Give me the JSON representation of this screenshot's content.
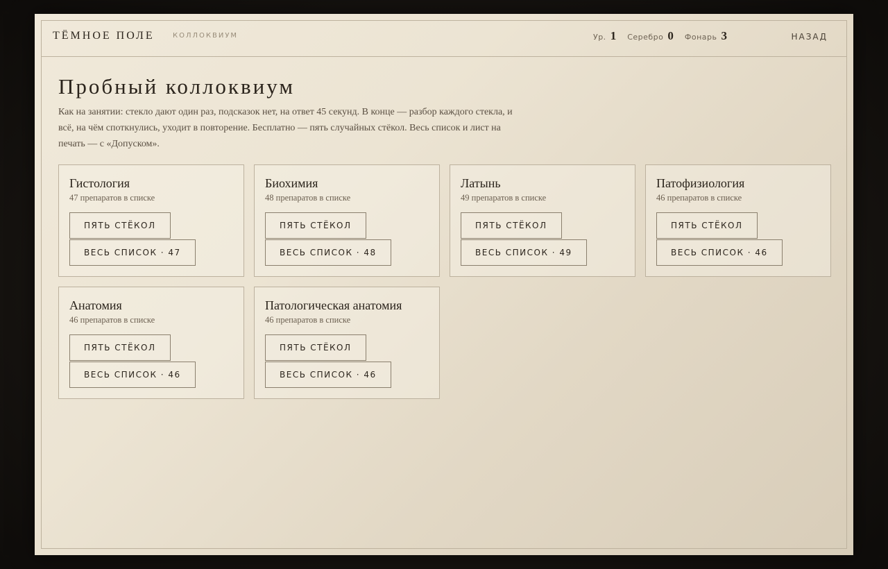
{
  "header": {
    "brand": "ТЁМНОЕ ПОЛЕ",
    "section": "КОЛЛОКВИУМ",
    "stats": [
      {
        "label": "Ур.",
        "value": "1"
      },
      {
        "label": "Серебро",
        "value": "0"
      },
      {
        "label": "Фонарь",
        "value": "3"
      }
    ],
    "back_label": "НАЗАД"
  },
  "main": {
    "title": "Пробный коллоквиум",
    "intro": "Как на занятии: стекло дают один раз, подсказок нет, на ответ 45 секунд. В конце — разбор каждого стекла, и всё, на чём споткнулись, уходит в повторение. Бесплатно — пять случайных стёкол. Весь список и лист на печать — с «Допуском».",
    "cards": [
      {
        "title": "Гистология",
        "count": "47 препаратов в списке",
        "five_label": "ПЯТЬ СТЁКОЛ",
        "all_label": "ВЕСЬ СПИСОК · 47"
      },
      {
        "title": "Биохимия",
        "count": "48 препаратов в списке",
        "five_label": "ПЯТЬ СТЁКОЛ",
        "all_label": "ВЕСЬ СПИСОК · 48"
      },
      {
        "title": "Латынь",
        "count": "49 препаратов в списке",
        "five_label": "ПЯТЬ СТЁКОЛ",
        "all_label": "ВЕСЬ СПИСОК · 49"
      },
      {
        "title": "Патофизиология",
        "count": "46 препаратов в списке",
        "five_label": "ПЯТЬ СТЁКОЛ",
        "all_label": "ВЕСЬ СПИСОК · 46"
      },
      {
        "title": "Анатомия",
        "count": "46 препаратов в списке",
        "five_label": "ПЯТЬ СТЁКОЛ",
        "all_label": "ВЕСЬ СПИСОК · 46"
      },
      {
        "title": "Патологическая анатомия",
        "count": "46 препаратов в списке",
        "five_label": "ПЯТЬ СТЁКОЛ",
        "all_label": "ВЕСЬ СПИСОК · 46"
      }
    ]
  },
  "colors": {
    "backdrop": "#15120f",
    "paper": "#ece4d3",
    "ink": "#2a231b",
    "rule": "#bdb29e"
  }
}
